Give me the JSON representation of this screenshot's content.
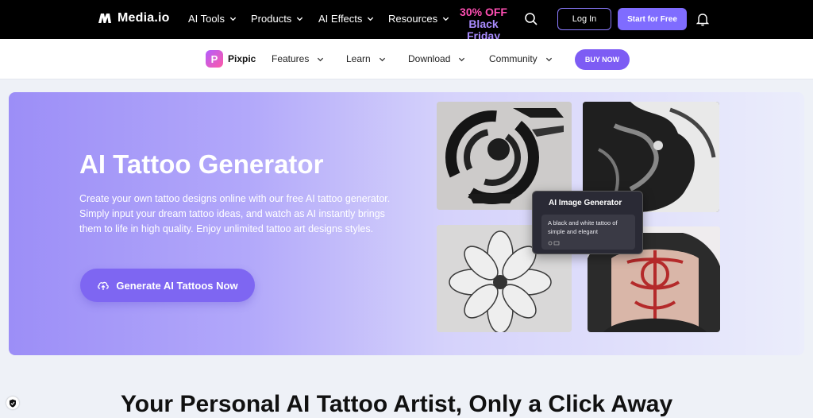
{
  "topbar": {
    "brand": "Media.io",
    "nav": [
      {
        "label": "AI Tools"
      },
      {
        "label": "Products"
      },
      {
        "label": "AI Effects"
      },
      {
        "label": "Resources"
      }
    ],
    "promo": {
      "line1": "30% OFF",
      "line2": "Black Friday"
    },
    "login_label": "Log In",
    "start_label": "Start for Free"
  },
  "subnav": {
    "brand": "Pixpic",
    "items": [
      {
        "label": "Features"
      },
      {
        "label": "Learn"
      },
      {
        "label": "Download"
      },
      {
        "label": "Community"
      }
    ],
    "buy_label": "BUY NOW"
  },
  "hero": {
    "title": "AI Tattoo Generator",
    "description": "Create your own tattoo designs online with our free AI tattoo generator. Simply input your dream tattoo ideas, and watch as AI instantly brings them to life in high quality. Enjoy unlimited tattoo art designs styles.",
    "cta_label": "Generate AI Tattoos Now",
    "popup": {
      "title": "AI Image Generator",
      "prompt": "A black and white tattoo of simple and elegant"
    }
  },
  "section": {
    "title": "Your Personal AI Tattoo Artist, Only a Click Away"
  },
  "colors": {
    "accent": "#7f6cff",
    "promo_pink": "#ff4fb3",
    "promo_purple": "#a98cff"
  }
}
